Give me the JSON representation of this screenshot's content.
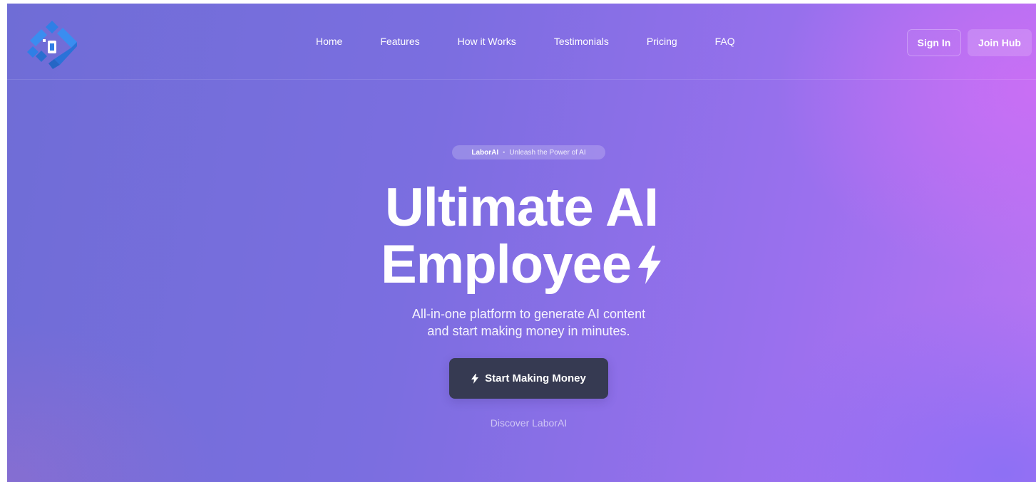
{
  "nav": {
    "logo_alt": "logo",
    "links": [
      "Home",
      "Features",
      "How it Works",
      "Testimonials",
      "Pricing",
      "FAQ"
    ],
    "signin_label": "Sign In",
    "join_label": "Join Hub"
  },
  "hero": {
    "badge_brand": "LaborAI",
    "badge_separator": "•",
    "badge_tagline": "Unleash the Power of AI",
    "headline_line1": "Ultimate AI",
    "headline_line2": "Employee",
    "subtext_line1": "All-in-one platform to generate AI content",
    "subtext_line2": "and start making money in minutes.",
    "cta_label": "Start Making Money",
    "discover_label": "Discover LaborAI"
  },
  "icons": {
    "logo": "brand-logo-icon",
    "headline_bolt": "lightning-bolt-icon",
    "cta_bolt": "lightning-bolt-icon"
  },
  "colors": {
    "gradient_start": "#6f6dd6",
    "gradient_end": "#b874f3",
    "cta_background": "#363a52",
    "logo_blue": "#2f7fe6"
  }
}
